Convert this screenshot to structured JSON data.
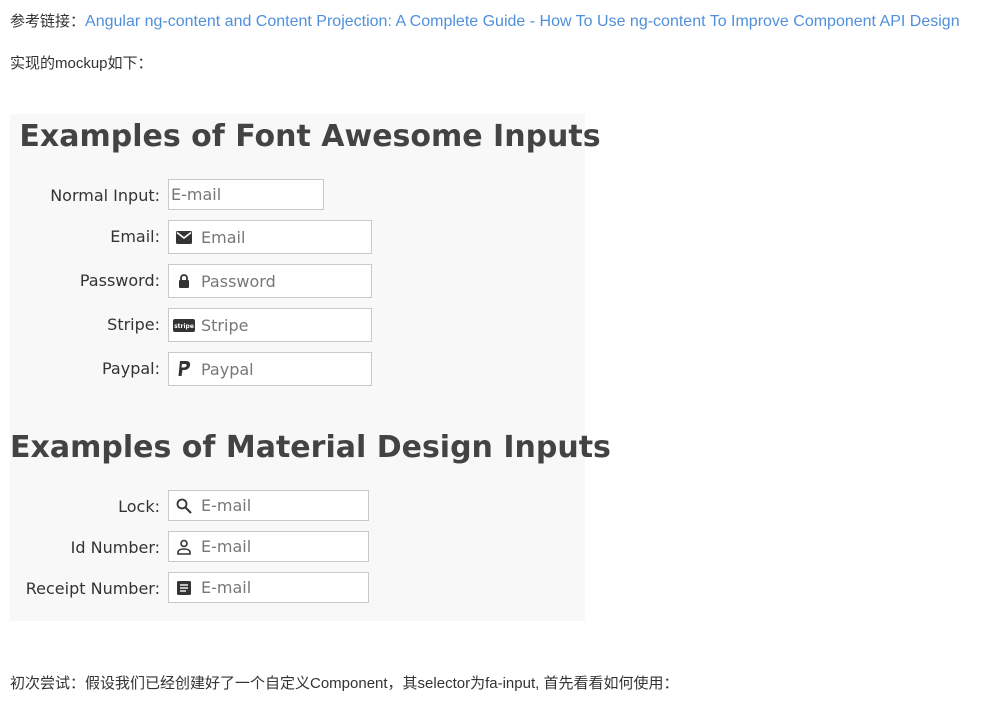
{
  "header": {
    "ref_prefix": "参考链接：",
    "ref_link_text": "Angular ng-content and Content Projection: A Complete Guide - How To Use ng-content To Improve Component API Design",
    "mockup_caption": "实现的mockup如下："
  },
  "mockup": {
    "fa_title": "Examples of Font Awesome Inputs",
    "fa_rows": [
      {
        "label": "Normal Input:",
        "placeholder": "E-mail",
        "icon": "none"
      },
      {
        "label": "Email:",
        "placeholder": "Email",
        "icon": "envelope-icon"
      },
      {
        "label": "Password:",
        "placeholder": "Password",
        "icon": "lock-icon"
      },
      {
        "label": "Stripe:",
        "placeholder": "Stripe",
        "icon": "stripe-icon"
      },
      {
        "label": "Paypal:",
        "placeholder": "Paypal",
        "icon": "paypal-icon"
      }
    ],
    "md_title": "Examples of Material Design Inputs",
    "md_rows": [
      {
        "label": "Lock:",
        "placeholder": "E-mail",
        "icon": "search-icon"
      },
      {
        "label": "Id Number:",
        "placeholder": "E-mail",
        "icon": "person-icon"
      },
      {
        "label": "Receipt Number:",
        "placeholder": "E-mail",
        "icon": "receipt-icon"
      }
    ],
    "stripe_icon_text": "stripe"
  },
  "footer": {
    "text": "初次尝试：假设我们已经创建好了一个自定义Component，其selector为fa-input, 首先看看如何使用："
  },
  "colors": {
    "link": "#4f8fdb",
    "panel_bg": "#f8f8f8",
    "title": "#434343"
  }
}
